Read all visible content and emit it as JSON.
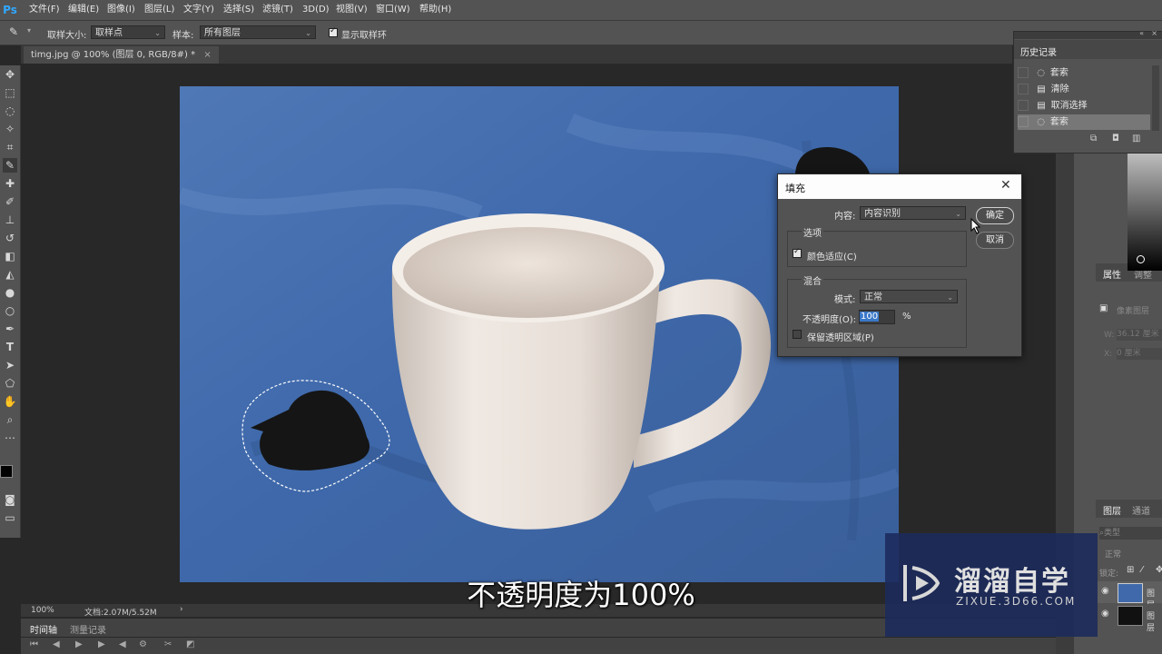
{
  "app": {
    "logo": "Ps"
  },
  "menu": [
    "文件(F)",
    "编辑(E)",
    "图像(I)",
    "图层(L)",
    "文字(Y)",
    "选择(S)",
    "滤镜(T)",
    "3D(D)",
    "视图(V)",
    "窗口(W)",
    "帮助(H)"
  ],
  "options": {
    "tool_icon": "eyedropper-icon",
    "sample_size_label": "取样大小:",
    "sample_size_value": "取样点",
    "sample_label": "样本:",
    "sample_value": "所有图层",
    "show_ring_label": "显示取样环",
    "show_ring_checked": true
  },
  "document": {
    "tab_title": "timg.jpg @ 100% (图层 0, RGB/8#) *",
    "close_glyph": "×"
  },
  "status": {
    "zoom": "100%",
    "doc_info": "文档:2.07M/5.52M",
    "arrow": "›"
  },
  "timeline": {
    "tabs": [
      "时间轴",
      "测量记录"
    ]
  },
  "history": {
    "title": "历史记录",
    "items": [
      {
        "label": "套索",
        "icon": "lasso-icon"
      },
      {
        "label": "清除",
        "icon": "history-state-icon"
      },
      {
        "label": "取消选择",
        "icon": "history-state-icon"
      },
      {
        "label": "套索",
        "icon": "lasso-icon",
        "active": true
      }
    ]
  },
  "properties": {
    "tabs": [
      "属性",
      "调整"
    ],
    "pixel_layer_label": "像素图层",
    "w_label": "W:",
    "w_value": "36.12 厘米",
    "x_label": "X:",
    "x_value": "0 厘米"
  },
  "layers": {
    "tabs": [
      "图层",
      "通道"
    ],
    "search_placeholder": "类型",
    "blend_mode": "正常",
    "lock_label": "锁定:",
    "layer_names": [
      "图层",
      "图层"
    ]
  },
  "fill_dialog": {
    "title": "填充",
    "content_label": "内容:",
    "content_value": "内容识别",
    "ok_label": "确定",
    "cancel_label": "取消",
    "options_group": "选项",
    "color_adapt_label": "颜色适应(C)",
    "color_adapt_checked": true,
    "blend_group": "混合",
    "mode_label": "模式:",
    "mode_value": "正常",
    "opacity_label": "不透明度(O):",
    "opacity_value": "100",
    "opacity_unit": "%",
    "preserve_label": "保留透明区域(P)",
    "preserve_checked": false
  },
  "subtitle": "不透明度为100%",
  "watermark": {
    "name": "溜溜自学",
    "url": "ZIXUE.3D66.COM"
  }
}
